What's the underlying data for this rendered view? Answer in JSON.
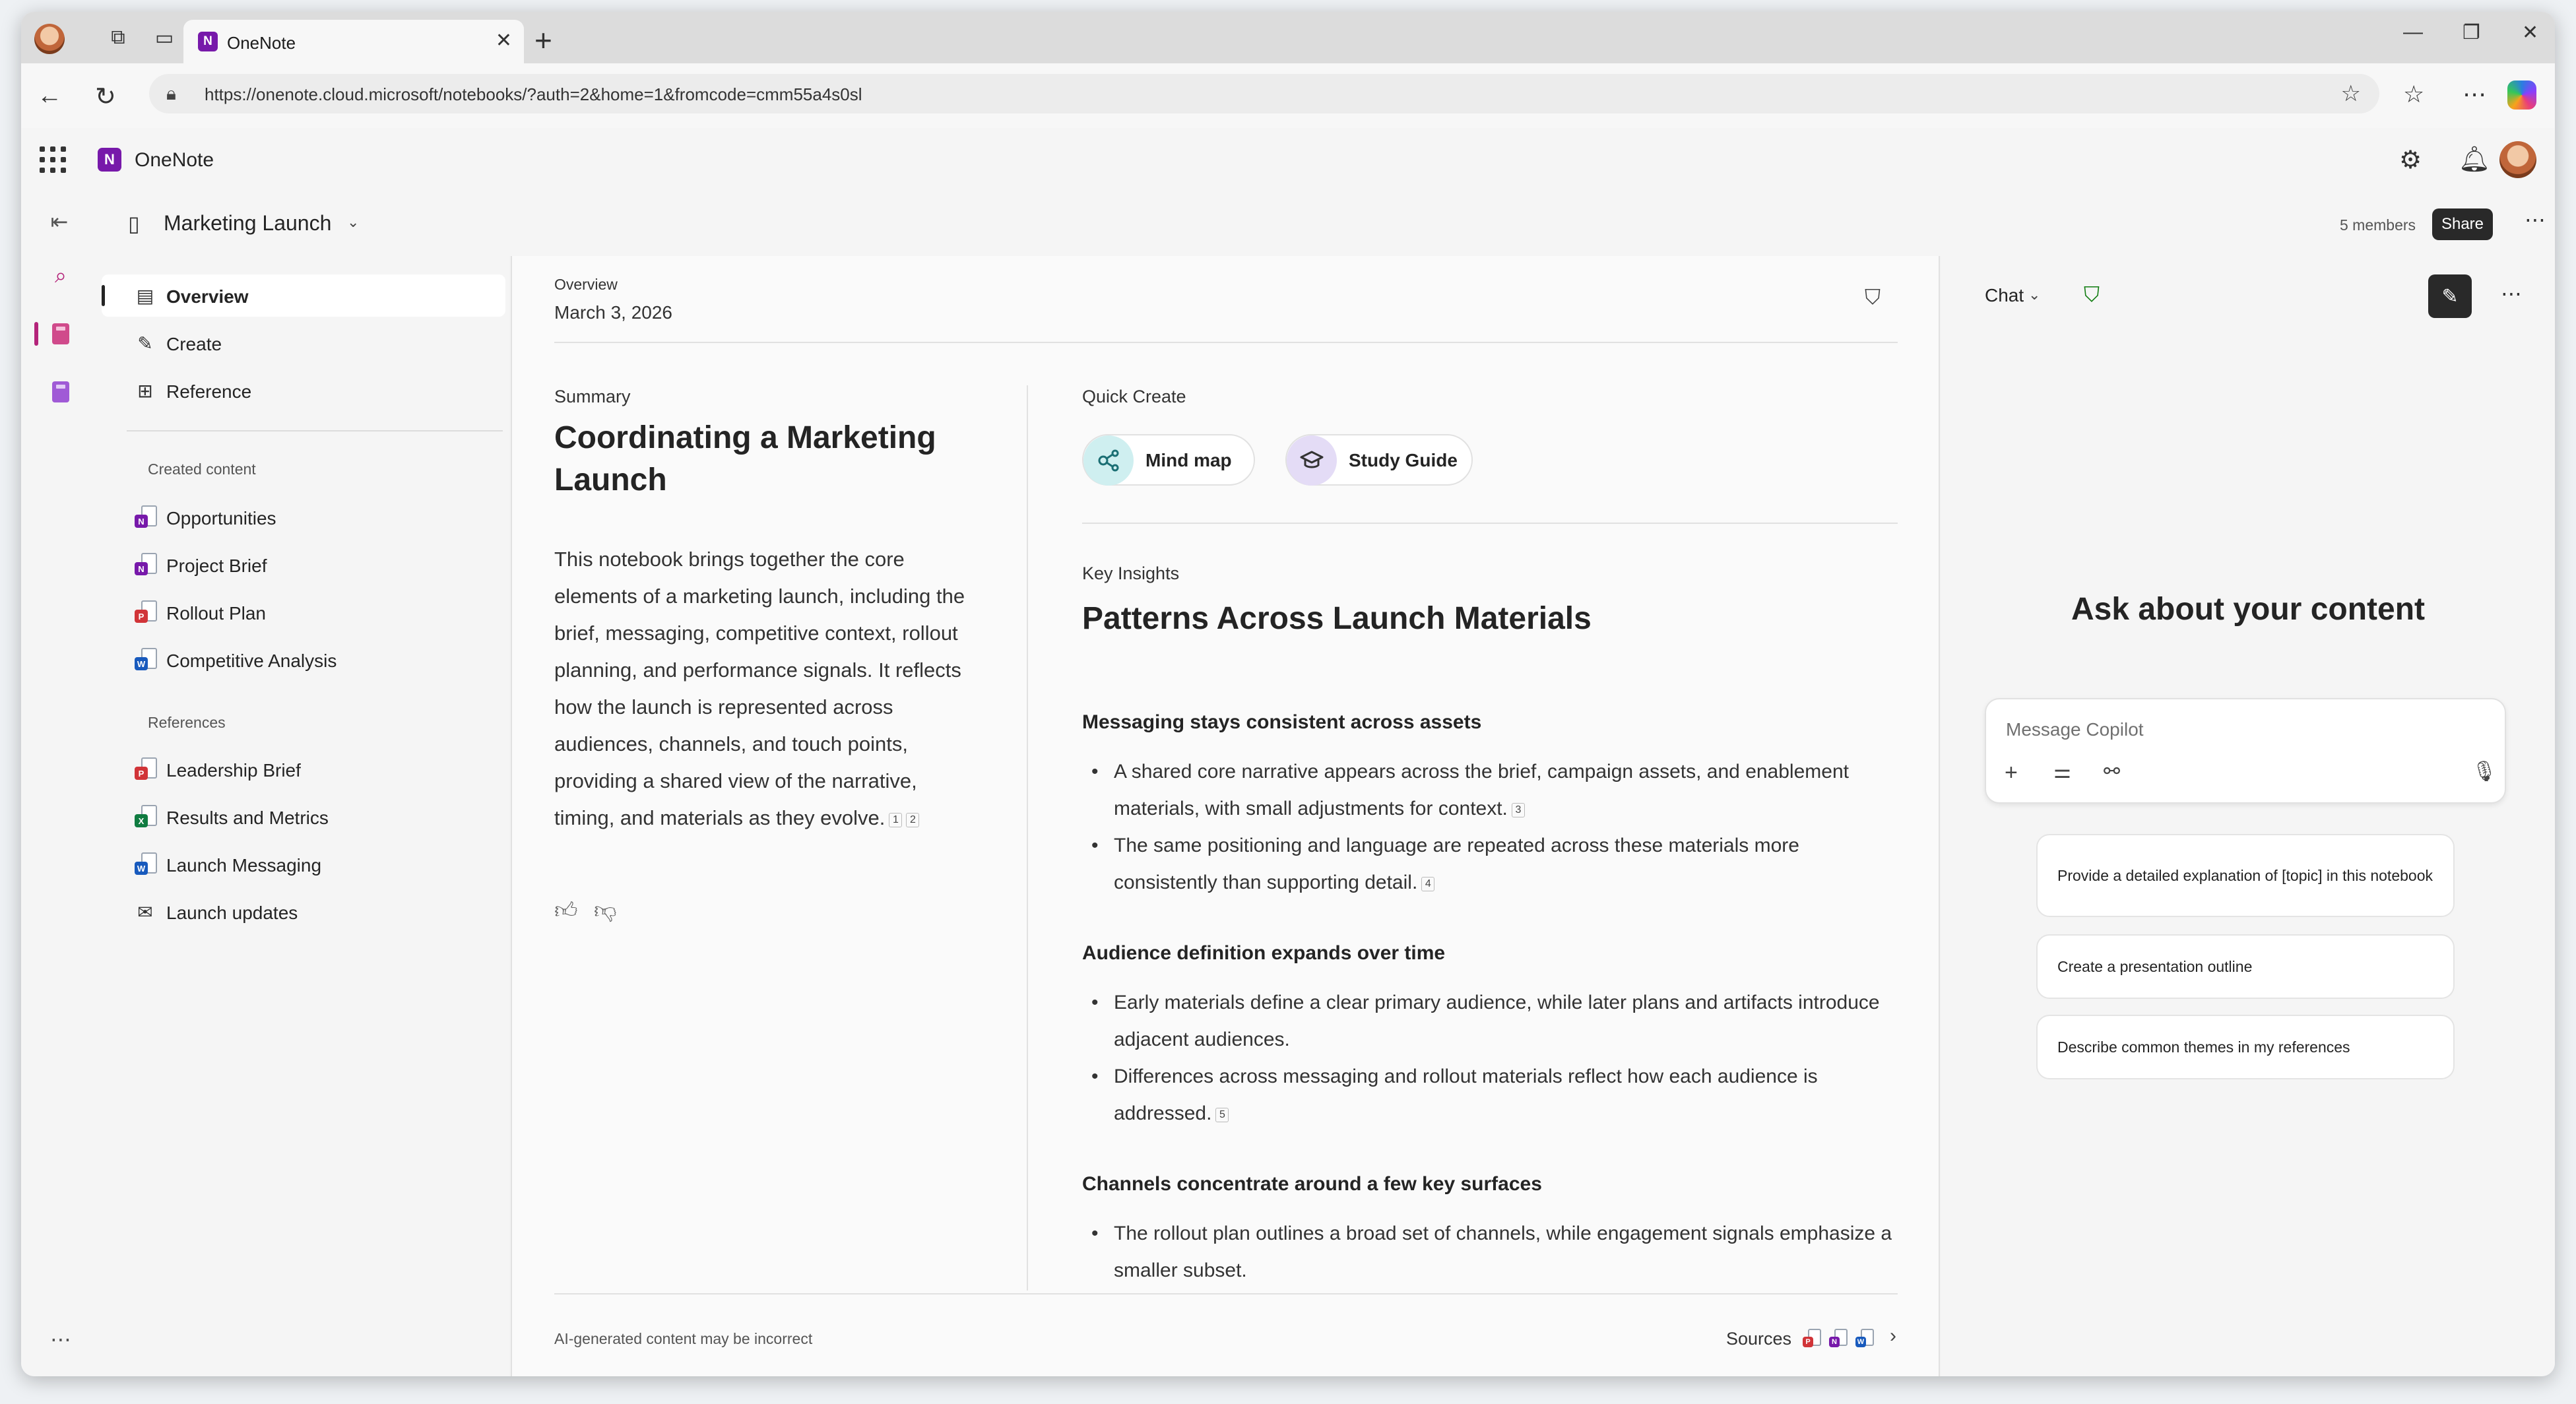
{
  "browser": {
    "tab_title": "OneNote",
    "url": "https://onenote.cloud.microsoft/notebooks/?auth=2&home=1&fromcode=cmm55a4s0sl",
    "new_tab_label": "+",
    "close_tab_glyph": "✕"
  },
  "app": {
    "name": "OneNote",
    "logo_letter": "N"
  },
  "notebook": {
    "title": "Marketing Launch",
    "members": "5 members",
    "share_label": "Share"
  },
  "nav": {
    "items": [
      {
        "label": "Overview",
        "icon": "overview-icon"
      },
      {
        "label": "Create",
        "icon": "create-icon"
      },
      {
        "label": "Reference",
        "icon": "reference-icon"
      }
    ],
    "created_heading": "Created content",
    "created": [
      {
        "label": "Opportunities",
        "type": "onenote"
      },
      {
        "label": "Project Brief",
        "type": "onenote"
      },
      {
        "label": "Rollout Plan",
        "type": "pdf"
      },
      {
        "label": "Competitive Analysis",
        "type": "word"
      }
    ],
    "references_heading": "References",
    "references": [
      {
        "label": "Leadership Brief",
        "type": "pdf"
      },
      {
        "label": "Results and Metrics",
        "type": "excel"
      },
      {
        "label": "Launch Messaging",
        "type": "word"
      },
      {
        "label": "Launch updates",
        "type": "mail"
      }
    ]
  },
  "overview": {
    "label": "Overview",
    "date": "March 3, 2026",
    "summary_label": "Summary",
    "summary_title": "Coordinating a Marketing Launch",
    "summary_body": "This notebook brings together the core elements of a marketing launch, including the brief, messaging, competitive context, rollout planning, and performance signals. It reflects how the launch is represented across audiences, channels, and touch points, providing a shared view of the narrative, timing, and materials as they evolve.",
    "summary_cites": [
      "1",
      "2"
    ],
    "quick_create_label": "Quick Create",
    "quick_create": [
      {
        "label": "Mind map",
        "icon": "mind-map-icon"
      },
      {
        "label": "Study Guide",
        "icon": "study-guide-icon"
      }
    ],
    "key_insights_label": "Key Insights",
    "key_insights_title": "Patterns Across Launch Materials",
    "insights": [
      {
        "heading": "Messaging stays consistent across assets",
        "bullets": [
          {
            "text": "A shared core narrative appears across the brief, campaign assets, and enablement materials, with small adjustments for context.",
            "cite": "3"
          },
          {
            "text": "The same positioning and language are repeated across these materials more consistently than supporting detail.",
            "cite": "4"
          }
        ]
      },
      {
        "heading": "Audience definition expands over time",
        "bullets": [
          {
            "text": "Early materials define a clear primary audience, while later plans and artifacts introduce adjacent audiences.",
            "cite": ""
          },
          {
            "text": "Differences across messaging and rollout materials reflect how each audience is addressed.",
            "cite": "5"
          }
        ]
      },
      {
        "heading": "Channels concentrate around a few key surfaces",
        "bullets": [
          {
            "text": "The rollout plan outlines a broad set of channels, while engagement signals emphasize a smaller subset.",
            "cite": ""
          }
        ]
      }
    ],
    "disclaimer": "AI-generated content may be incorrect",
    "sources_label": "Sources"
  },
  "chat": {
    "title": "Chat",
    "heading": "Ask about your content",
    "placeholder": "Message Copilot",
    "suggestions": [
      "Provide a detailed explanation of [topic] in this notebook",
      "Create a presentation outline",
      "Describe common themes in my references"
    ]
  },
  "colors": {
    "onenote": "#7719aa",
    "pdf": "#d13438",
    "word": "#185abd",
    "excel": "#107c41",
    "accent": "#b4247a",
    "shield_ok": "#107c10"
  }
}
